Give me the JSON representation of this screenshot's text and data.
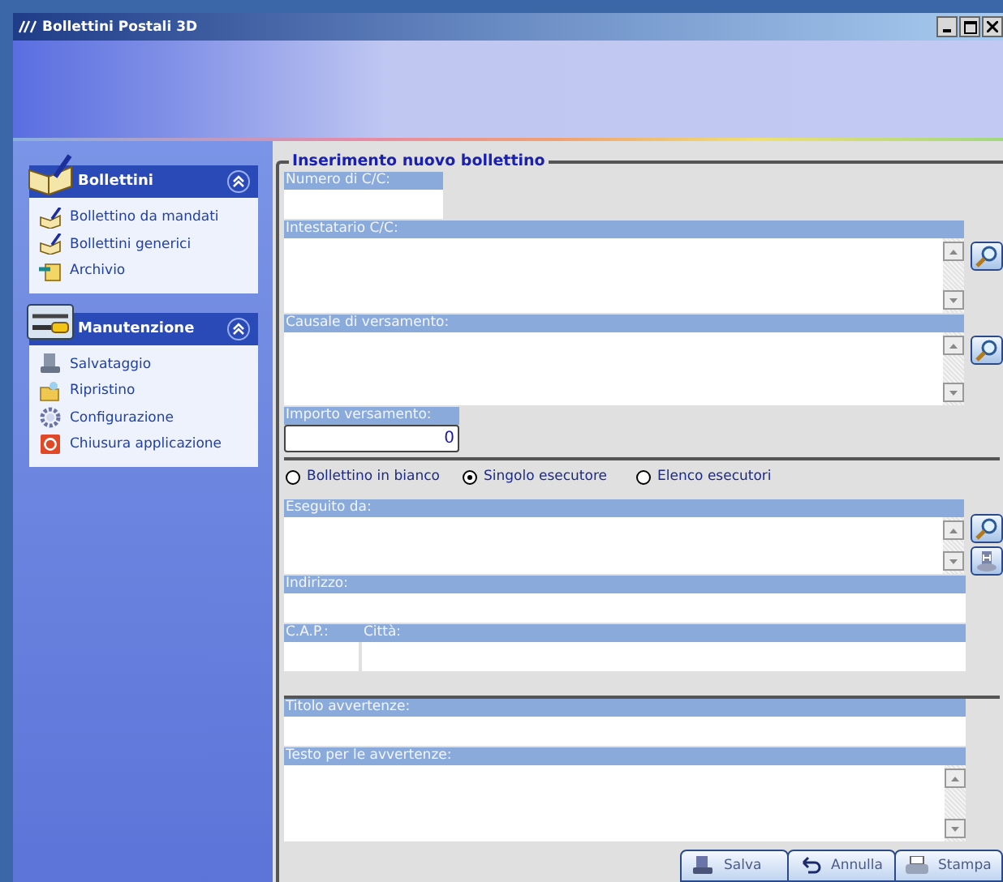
{
  "window": {
    "title": "Bollettini Postali 3D"
  },
  "sidebar": {
    "groups": [
      {
        "title": "Bollettini",
        "expanded": true,
        "items": [
          {
            "label": "Bollettino da mandati"
          },
          {
            "label": "Bollettini generici"
          },
          {
            "label": "Archivio"
          }
        ]
      },
      {
        "title": "Manutenzione",
        "expanded": true,
        "items": [
          {
            "label": "Salvataggio"
          },
          {
            "label": "Ripristino"
          },
          {
            "label": "Configurazione"
          },
          {
            "label": "Chiusura applicazione"
          }
        ]
      }
    ]
  },
  "form": {
    "legend": "Inserimento nuovo bollettino",
    "rows": [
      {
        "kind": "short",
        "label": "Numero di C/C:"
      },
      {
        "kind": "memo",
        "label": "Intestatario C/C:",
        "tools": [
          {
            "kind": "search"
          }
        ]
      },
      {
        "kind": "memo",
        "label": "Causale di versamento:",
        "tools": [
          {
            "kind": "search"
          }
        ]
      },
      {
        "kind": "amount",
        "label": "Importo versamento:",
        "value": "0"
      },
      {
        "kind": "divider"
      },
      {
        "kind": "radios",
        "options": [
          {
            "label": "Bollettino in bianco",
            "selected": false
          },
          {
            "label": "Singolo esecutore",
            "selected": true
          },
          {
            "label": "Elenco esecutori",
            "selected": false
          }
        ]
      },
      {
        "kind": "memo",
        "label": "Eseguito da:",
        "tools": [
          {
            "kind": "search"
          },
          {
            "kind": "contact"
          }
        ]
      },
      {
        "kind": "line",
        "label": "Indirizzo:"
      },
      {
        "kind": "split",
        "labels": [
          "C.A.P.:",
          "Città:"
        ]
      },
      {
        "kind": "divider"
      },
      {
        "kind": "line",
        "label": "Titolo avvertenze:"
      },
      {
        "kind": "memo",
        "label": "Testo per le avvertenze:",
        "tools": []
      }
    ]
  },
  "buttons": [
    {
      "kind": "save",
      "label": "Salva"
    },
    {
      "kind": "undo",
      "label": "Annulla"
    },
    {
      "kind": "print",
      "label": "Stampa"
    }
  ]
}
